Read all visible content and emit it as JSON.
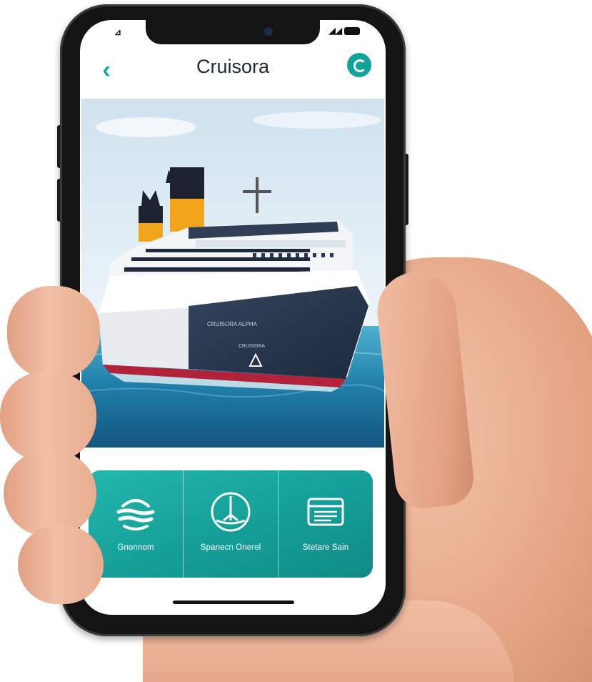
{
  "status_bar": {
    "left_glyph": "⊿",
    "right_glyph": "◢◢"
  },
  "header": {
    "title": "Cruisora",
    "back_icon": "chevron-left-icon",
    "logo_icon": "brand-logo-icon"
  },
  "hero": {
    "ship_name_text": "CRUISORA ALPHA",
    "ship_port_text": "CRUISORA"
  },
  "features": [
    {
      "label": "Gnonnom",
      "icon": "waves-icon"
    },
    {
      "label": "Spanecn Onerel",
      "icon": "steering-wheel-icon"
    },
    {
      "label": "Stetare Sain",
      "icon": "ticket-icon"
    }
  ],
  "colors": {
    "accent": "#1aa8a2",
    "card_gradient_start": "#22b7ad",
    "card_gradient_end": "#0f8b87",
    "title": "#1f2a36",
    "hull": "#2b3a52",
    "funnel": "#f0a51c"
  }
}
